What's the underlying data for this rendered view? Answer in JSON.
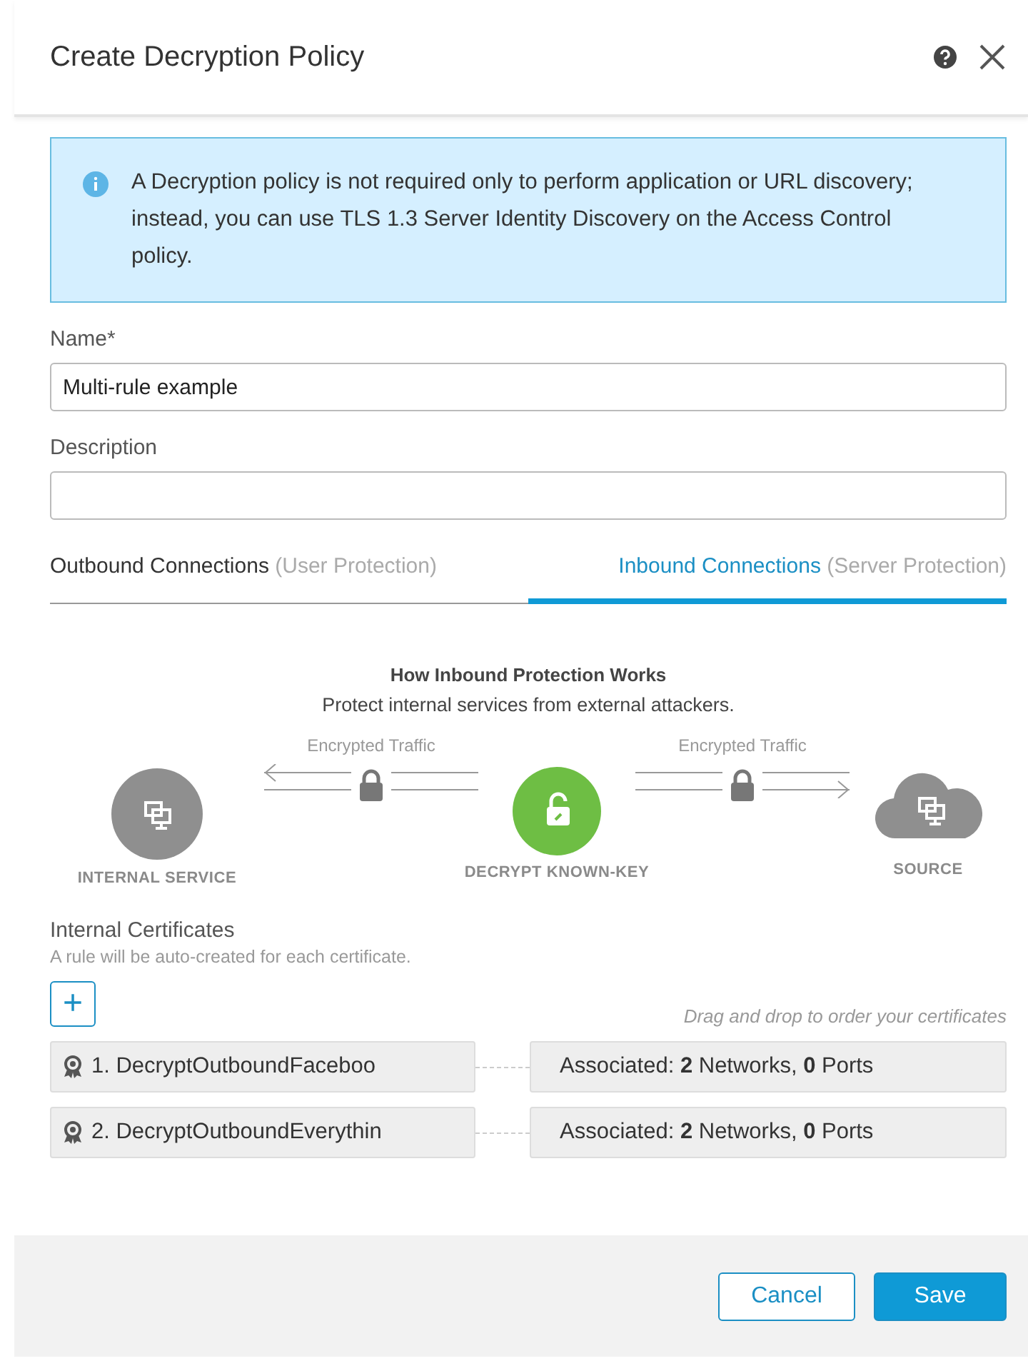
{
  "dialog": {
    "title": "Create Decryption Policy"
  },
  "notice": "A Decryption policy is not required only to perform application or URL discovery; instead, you can use TLS 1.3 Server Identity Discovery on the Access Control policy.",
  "fields": [
    {
      "label": "Name*",
      "value": "Multi-rule example"
    },
    {
      "label": "Description"
    }
  ],
  "tabs": [
    {
      "label": "Outbound Connections",
      "hint": "(User Protection)",
      "selected": false
    },
    {
      "label": "Inbound Connections",
      "hint": "(Server Protection)",
      "selected": true
    }
  ],
  "diagram": {
    "title": "How Inbound Protection Works",
    "subtitle": "Protect internal services from external attackers.",
    "traffic_labels": [
      "Encrypted Traffic",
      "Encrypted Traffic"
    ],
    "nodes": [
      {
        "label": "INTERNAL SERVICE",
        "kind": "server"
      },
      {
        "label": "DECRYPT KNOWN-KEY",
        "kind": "decrypt"
      },
      {
        "label": "SOURCE",
        "kind": "cloud"
      }
    ]
  },
  "certificates": {
    "title": "Internal Certificates",
    "subtitle": "A rule will be auto-created for each certificate.",
    "add_button": "+",
    "hint": "Drag and drop to order your certificates",
    "items": [
      {
        "name": "1. DecryptOutboundFaceboo",
        "association": "Associated: **2** Networks, **0** Ports"
      },
      {
        "name": "2. DecryptOutboundEverythin",
        "association": "Associated: **2** Networks, **0** Ports"
      }
    ]
  },
  "buttons": {
    "cancel": "Cancel",
    "save": "Save"
  }
}
